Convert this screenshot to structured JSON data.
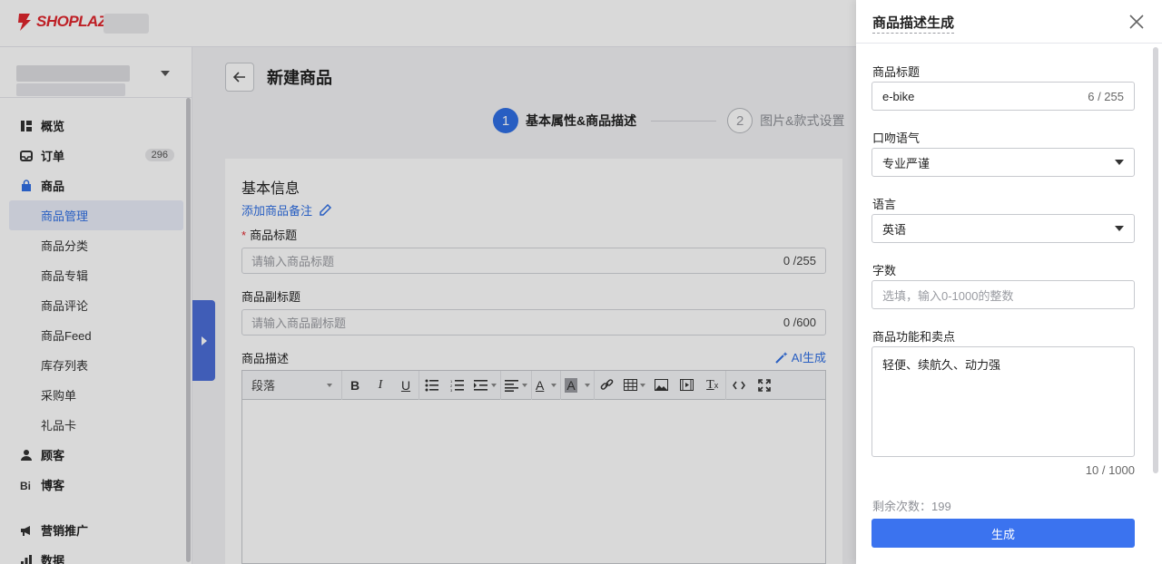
{
  "brand": {
    "name": "SHOPLAZZA",
    "color": "#e0262d"
  },
  "accent_color": "#2f6fe4",
  "sidebar": {
    "items": [
      {
        "label": "概览",
        "icon": "dashboard-icon",
        "level": "top"
      },
      {
        "label": "订单",
        "icon": "inbox-icon",
        "level": "top",
        "badge": "296"
      },
      {
        "label": "商品",
        "icon": "bag-icon",
        "level": "top"
      },
      {
        "label": "商品管理",
        "level": "sub",
        "active": true
      },
      {
        "label": "商品分类",
        "level": "sub"
      },
      {
        "label": "商品专辑",
        "level": "sub"
      },
      {
        "label": "商品评论",
        "level": "sub"
      },
      {
        "label": "商品Feed",
        "level": "sub"
      },
      {
        "label": "库存列表",
        "level": "sub"
      },
      {
        "label": "采购单",
        "level": "sub"
      },
      {
        "label": "礼品卡",
        "level": "sub"
      },
      {
        "label": "顾客",
        "icon": "user-icon",
        "level": "top"
      },
      {
        "label": "博客",
        "icon": "blog-icon",
        "level": "top"
      },
      {
        "label": "营销推广",
        "icon": "megaphone-icon",
        "level": "top"
      },
      {
        "label": "数据",
        "icon": "bar-chart-icon",
        "level": "top"
      }
    ]
  },
  "main": {
    "title": "新建商品",
    "steps": [
      {
        "number": "1",
        "label": "基本属性&商品描述",
        "active": true
      },
      {
        "number": "2",
        "label": "图片&款式设置",
        "active": false
      }
    ],
    "card": {
      "title": "基本信息",
      "add_note": "添加商品备注",
      "title_field": {
        "label": "商品标题",
        "placeholder": "请输入商品标题",
        "count": "0 /255"
      },
      "subtitle_field": {
        "label": "商品副标题",
        "placeholder": "请输入商品副标题",
        "count": "0 /600"
      },
      "desc_field": {
        "label": "商品描述",
        "ai_label": "AI生成"
      },
      "editor": {
        "paragraph": "段落"
      }
    }
  },
  "drawer": {
    "title": "商品描述生成",
    "product_title": {
      "label": "商品标题",
      "value": "e-bike",
      "count": "6 / 255"
    },
    "tone": {
      "label": "口吻语气",
      "value": "专业严谨"
    },
    "language": {
      "label": "语言",
      "value": "英语"
    },
    "word_count": {
      "label": "字数",
      "placeholder": "选填，输入0-1000的整数"
    },
    "features": {
      "label": "商品功能和卖点",
      "value": "轻便、续航久、动力强",
      "count": "10 / 1000"
    },
    "remaining": "剩余次数：199",
    "generate_button": "生成",
    "button_color": "#3b73ef"
  }
}
